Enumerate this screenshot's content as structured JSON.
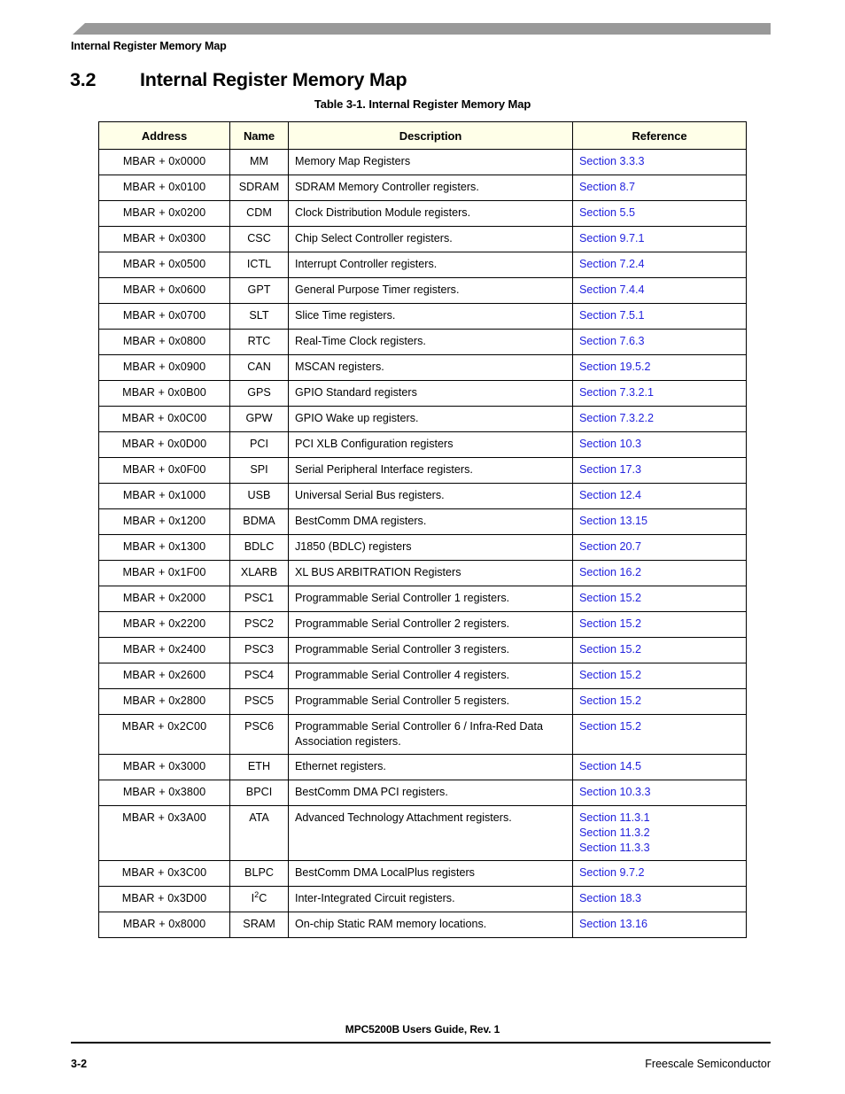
{
  "page": {
    "running_head": "Internal Register Memory Map",
    "accent_bar_color": "#999999",
    "link_color": "#2222DD",
    "header_row_color": "#FFFFE8"
  },
  "section": {
    "number": "3.2",
    "title": "Internal Register Memory Map"
  },
  "table": {
    "caption": "Table 3-1. Internal Register Memory Map",
    "columns": [
      "Address",
      "Name",
      "Description",
      "Reference"
    ],
    "rows": [
      {
        "address": "MBAR  +  0x0000",
        "name": "MM",
        "description": "Memory Map Registers",
        "references": [
          "Section 3.3.3"
        ]
      },
      {
        "address": "MBAR  +  0x0100",
        "name": "SDRAM",
        "description": "SDRAM Memory Controller registers.",
        "references": [
          "Section 8.7"
        ]
      },
      {
        "address": "MBAR  +  0x0200",
        "name": "CDM",
        "description": "Clock Distribution Module registers.",
        "references": [
          "Section 5.5"
        ]
      },
      {
        "address": "MBAR  +  0x0300",
        "name": "CSC",
        "description": "Chip Select Controller registers.",
        "references": [
          "Section 9.7.1"
        ]
      },
      {
        "address": "MBAR  +  0x0500",
        "name": "ICTL",
        "description": "Interrupt Controller registers.",
        "references": [
          "Section 7.2.4"
        ]
      },
      {
        "address": "MBAR  +  0x0600",
        "name": "GPT",
        "description": "General Purpose Timer registers.",
        "references": [
          "Section 7.4.4"
        ]
      },
      {
        "address": "MBAR  +  0x0700",
        "name": "SLT",
        "description": "Slice Time registers.",
        "references": [
          "Section 7.5.1"
        ]
      },
      {
        "address": "MBAR  +  0x0800",
        "name": "RTC",
        "description": "Real-Time Clock registers.",
        "references": [
          "Section 7.6.3"
        ]
      },
      {
        "address": "MBAR  +  0x0900",
        "name": "CAN",
        "description": "MSCAN registers.",
        "references": [
          "Section 19.5.2"
        ]
      },
      {
        "address": "MBAR  +  0x0B00",
        "name": "GPS",
        "description": "GPIO Standard registers",
        "references": [
          "Section 7.3.2.1"
        ]
      },
      {
        "address": "MBAR  +  0x0C00",
        "name": "GPW",
        "description": "GPIO Wake up registers.",
        "references": [
          "Section 7.3.2.2"
        ]
      },
      {
        "address": "MBAR  +  0x0D00",
        "name": "PCI",
        "description": "PCI XLB Configuration registers",
        "references": [
          "Section 10.3"
        ]
      },
      {
        "address": "MBAR  +  0x0F00",
        "name": "SPI",
        "description": "Serial Peripheral Interface registers.",
        "references": [
          "Section 17.3"
        ]
      },
      {
        "address": "MBAR  +  0x1000",
        "name": "USB",
        "description": "Universal Serial Bus registers.",
        "references": [
          "Section 12.4"
        ]
      },
      {
        "address": "MBAR  +  0x1200",
        "name": "BDMA",
        "description": "BestComm DMA registers.",
        "references": [
          "Section 13.15"
        ]
      },
      {
        "address": "MBAR + 0x1300",
        "name": "BDLC",
        "description": "J1850 (BDLC) registers",
        "references": [
          "Section 20.7"
        ]
      },
      {
        "address": "MBAR + 0x1F00",
        "name": "XLARB",
        "description": "XL BUS ARBITRATION Registers",
        "references": [
          "Section 16.2"
        ]
      },
      {
        "address": "MBAR  +  0x2000",
        "name": "PSC1",
        "description": "Programmable Serial Controller 1 registers.",
        "references": [
          "Section 15.2"
        ]
      },
      {
        "address": "MBAR  +  0x2200",
        "name": "PSC2",
        "description": "Programmable Serial Controller 2 registers.",
        "references": [
          "Section 15.2"
        ]
      },
      {
        "address": "MBAR  +  0x2400",
        "name": "PSC3",
        "description": "Programmable Serial Controller 3 registers.",
        "references": [
          "Section 15.2"
        ]
      },
      {
        "address": "MBAR  +  0x2600",
        "name": "PSC4",
        "description": "Programmable Serial Controller 4 registers.",
        "references": [
          "Section 15.2"
        ]
      },
      {
        "address": "MBAR  +  0x2800",
        "name": "PSC5",
        "description": "Programmable Serial Controller 5 registers.",
        "references": [
          "Section 15.2"
        ]
      },
      {
        "address": "MBAR  +  0x2C00",
        "name": "PSC6",
        "description": "Programmable Serial Controller 6 / Infra-Red Data Association registers.",
        "references": [
          "Section 15.2"
        ]
      },
      {
        "address": "MBAR  +  0x3000",
        "name": "ETH",
        "description": "Ethernet registers.",
        "references": [
          "Section 14.5"
        ]
      },
      {
        "address": "MBAR  +  0x3800",
        "name": "BPCI",
        "description": "BestComm DMA PCI registers.",
        "references": [
          "Section 10.3.3"
        ]
      },
      {
        "address": "MBAR  +  0x3A00",
        "name": "ATA",
        "description": "Advanced Technology Attachment registers.",
        "references": [
          "Section 11.3.1",
          "Section 11.3.2",
          "Section 11.3.3"
        ]
      },
      {
        "address": "MBAR + 0x3C00",
        "name": "BLPC",
        "description": "BestComm DMA LocalPlus registers",
        "references": [
          "Section 9.7.2"
        ]
      },
      {
        "address": "MBAR  +  0x3D00",
        "name": "I<sup>2</sup>C",
        "name_is_html": true,
        "description": "Inter-Integrated Circuit registers.",
        "references": [
          "Section 18.3"
        ]
      },
      {
        "address": "MBAR  +  0x8000",
        "name": "SRAM",
        "description": "On-chip Static RAM memory locations.",
        "references": [
          "Section 13.16"
        ]
      }
    ]
  },
  "footer": {
    "document_title": "MPC5200B Users Guide, Rev. 1",
    "page_number": "3-2",
    "company": "Freescale Semiconductor"
  }
}
